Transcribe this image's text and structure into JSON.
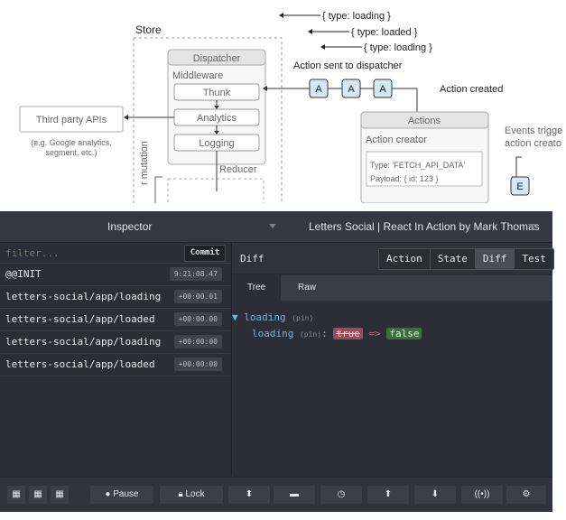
{
  "diagram": {
    "store_label": "Store",
    "dispatcher_label": "Dispatcher",
    "middleware_label": "Middleware",
    "thunk_label": "Thunk",
    "analytics_label": "Analytics",
    "logging_label": "Logging",
    "reducer_label": "Reducer",
    "third_party_label": "Third party APIs",
    "third_party_note_1": "(e.g. Google analytics,",
    "third_party_note_2": "segment, etc.)",
    "mutation_label": "r mutation",
    "action_sent_label": "Action sent to dispatcher",
    "action_created_label": "Action created",
    "actions_label": "Actions",
    "action_creator_label": "Action creator",
    "type_text": "Type: 'FETCH_API_DATA'",
    "payload_text": "Payload: { id: 123 }",
    "events_label_1": "Events trigge",
    "events_label_2": "action creato",
    "type_loading_1": "{ type: loading }",
    "type_loaded": "{ type: loaded }",
    "type_loading_2": "{ type: loading }",
    "action_badge": "A",
    "e_badge": "E"
  },
  "topbar": {
    "inspector_label": "Inspector",
    "instance_label": "Letters Social | React In Action by Mark Thomas"
  },
  "filter": {
    "placeholder": "filter...",
    "commit_label": "Commit"
  },
  "actions": [
    {
      "name": "@@INIT",
      "time": "9:21:08.47"
    },
    {
      "name": "letters-social/app/loading",
      "time": "+00:00.01"
    },
    {
      "name": "letters-social/app/loaded",
      "time": "+00:00.00"
    },
    {
      "name": "letters-social/app/loading",
      "time": "+00:00:00"
    },
    {
      "name": "letters-social/app/loaded",
      "time": "+00:00:00"
    }
  ],
  "diff": {
    "title": "Diff",
    "tabs": [
      "Action",
      "State",
      "Diff",
      "Test"
    ],
    "active_tab": "Diff",
    "subtabs": [
      "Tree",
      "Raw"
    ],
    "parent_key": "loading",
    "pin": "(pin)",
    "child_key": "loading",
    "old_value": "true",
    "arrow": "=>",
    "new_value": "false"
  },
  "bottombar": {
    "pause_label": "Pause",
    "lock_label": "Lock"
  }
}
